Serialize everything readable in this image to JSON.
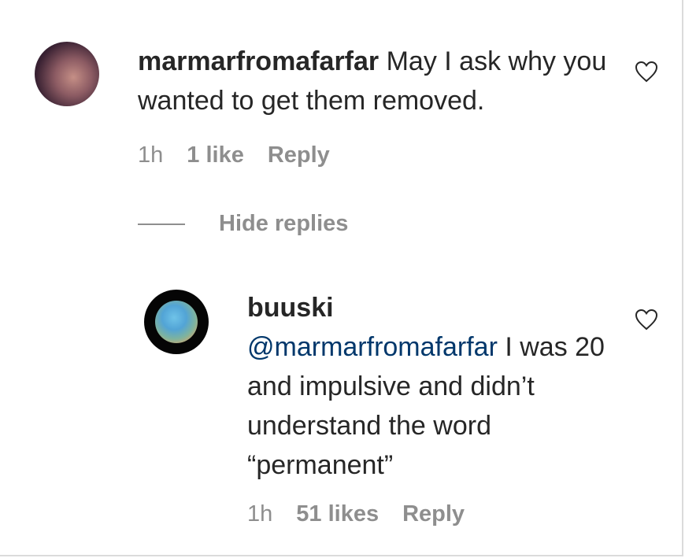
{
  "comment": {
    "username": "marmarfromafarfar",
    "text": "May I ask why you wanted to get them removed.",
    "time": "1h",
    "likes": "1 like",
    "reply_label": "Reply",
    "avatar_icon": "profile-photo"
  },
  "hide_replies_label": "Hide replies",
  "reply": {
    "username": "buuski",
    "mention": "@marmarfromafarfar",
    "text": "I was 20 and impulsive and didn’t understand the word “permanent”",
    "time": "1h",
    "likes": "51 likes",
    "reply_label": "Reply",
    "avatar_icon": "planet-photo"
  },
  "icons": {
    "like": "heart-outline-icon"
  },
  "colors": {
    "text": "#262626",
    "secondary": "#8e8e8e",
    "mention": "#00376b"
  }
}
